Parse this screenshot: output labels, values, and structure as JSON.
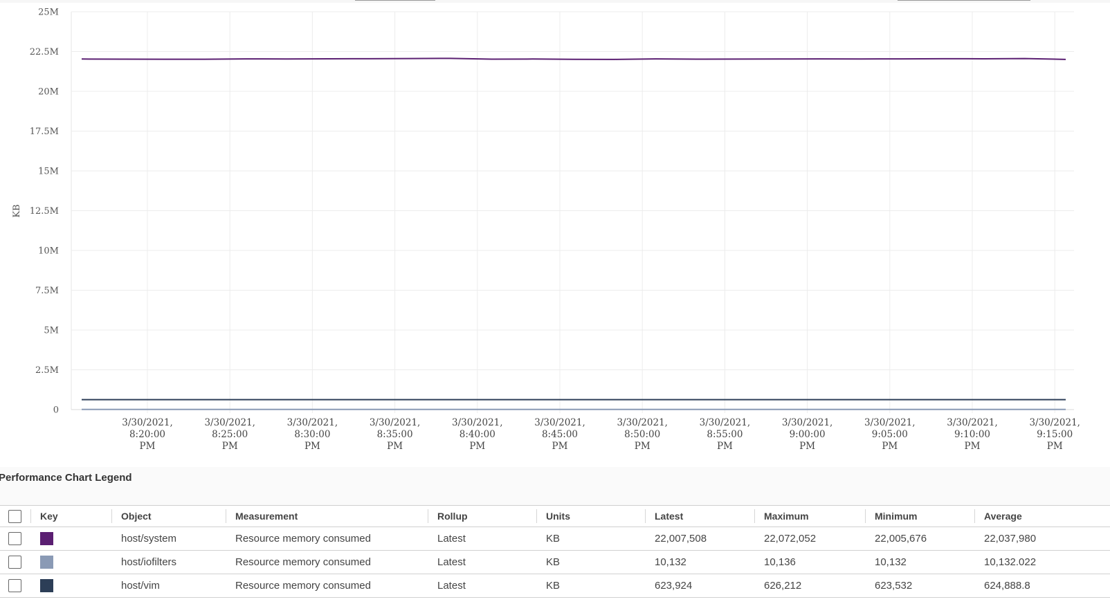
{
  "chart_data": {
    "type": "line",
    "ylabel": "KB",
    "ylim": [
      0,
      25000000
    ],
    "y_ticks": [
      "25M",
      "22.5M",
      "20M",
      "17.5M",
      "15M",
      "12.5M",
      "10M",
      "7.5M",
      "5M",
      "2.5M",
      "0"
    ],
    "y_tick_values": [
      25000000,
      22500000,
      20000000,
      17500000,
      15000000,
      12500000,
      10000000,
      7500000,
      5000000,
      2500000,
      0
    ],
    "x_ticks": [
      [
        "3/30/2021,",
        "8:20:00",
        "PM"
      ],
      [
        "3/30/2021,",
        "8:25:00",
        "PM"
      ],
      [
        "3/30/2021,",
        "8:30:00",
        "PM"
      ],
      [
        "3/30/2021,",
        "8:35:00",
        "PM"
      ],
      [
        "3/30/2021,",
        "8:40:00",
        "PM"
      ],
      [
        "3/30/2021,",
        "8:45:00",
        "PM"
      ],
      [
        "3/30/2021,",
        "8:50:00",
        "PM"
      ],
      [
        "3/30/2021,",
        "8:55:00",
        "PM"
      ],
      [
        "3/30/2021,",
        "9:00:00",
        "PM"
      ],
      [
        "3/30/2021,",
        "9:05:00",
        "PM"
      ],
      [
        "3/30/2021,",
        "9:10:00",
        "PM"
      ],
      [
        "3/30/2021,",
        "9:15:00",
        "PM"
      ]
    ],
    "x_range_minutes_from_820pm": [
      -4,
      60
    ],
    "grid": true,
    "series": [
      {
        "name": "host/system",
        "color": "#5b1f72",
        "values": [
          22030000,
          22020000,
          22018000,
          22015000,
          22040000,
          22035000,
          22045000,
          22050000,
          22060000,
          22072052,
          22020000,
          22030000,
          22010000,
          22007508,
          22040000,
          22020000,
          22025000,
          22030000,
          22040000,
          22035000,
          22040000,
          22050000,
          22045000,
          22060000,
          22007508
        ]
      },
      {
        "name": "host/iofilters",
        "color": "#8a9ab5",
        "values": [
          10132,
          10132,
          10132,
          10132,
          10136,
          10132,
          10132,
          10132,
          10132,
          10132,
          10132,
          10132,
          10132,
          10132,
          10132,
          10132,
          10132,
          10132,
          10132,
          10132,
          10132,
          10132,
          10132,
          10132,
          10132
        ]
      },
      {
        "name": "host/vim",
        "color": "#2c3e57",
        "values": [
          624500,
          625000,
          624800,
          626212,
          624000,
          623532,
          625100,
          624900,
          624700,
          625300,
          624800,
          624600,
          625200,
          624900,
          624800,
          625000,
          624700,
          624900,
          625100,
          624800,
          624900,
          625000,
          624800,
          624900,
          623924
        ]
      }
    ]
  },
  "legend": {
    "title": "Performance Chart Legend",
    "headers": {
      "key": "Key",
      "object": "Object",
      "measurement": "Measurement",
      "rollup": "Rollup",
      "units": "Units",
      "latest": "Latest",
      "maximum": "Maximum",
      "minimum": "Minimum",
      "average": "Average"
    },
    "rows": [
      {
        "color": "#5b1f72",
        "object": "host/system",
        "measurement": "Resource memory consumed",
        "rollup": "Latest",
        "units": "KB",
        "latest": "22,007,508",
        "maximum": "22,072,052",
        "minimum": "22,005,676",
        "average": "22,037,980"
      },
      {
        "color": "#8a9ab5",
        "object": "host/iofilters",
        "measurement": "Resource memory consumed",
        "rollup": "Latest",
        "units": "KB",
        "latest": "10,132",
        "maximum": "10,136",
        "minimum": "10,132",
        "average": "10,132.022"
      },
      {
        "color": "#2c3e57",
        "object": "host/vim",
        "measurement": "Resource memory consumed",
        "rollup": "Latest",
        "units": "KB",
        "latest": "623,924",
        "maximum": "626,212",
        "minimum": "623,532",
        "average": "624,888.8"
      }
    ]
  }
}
